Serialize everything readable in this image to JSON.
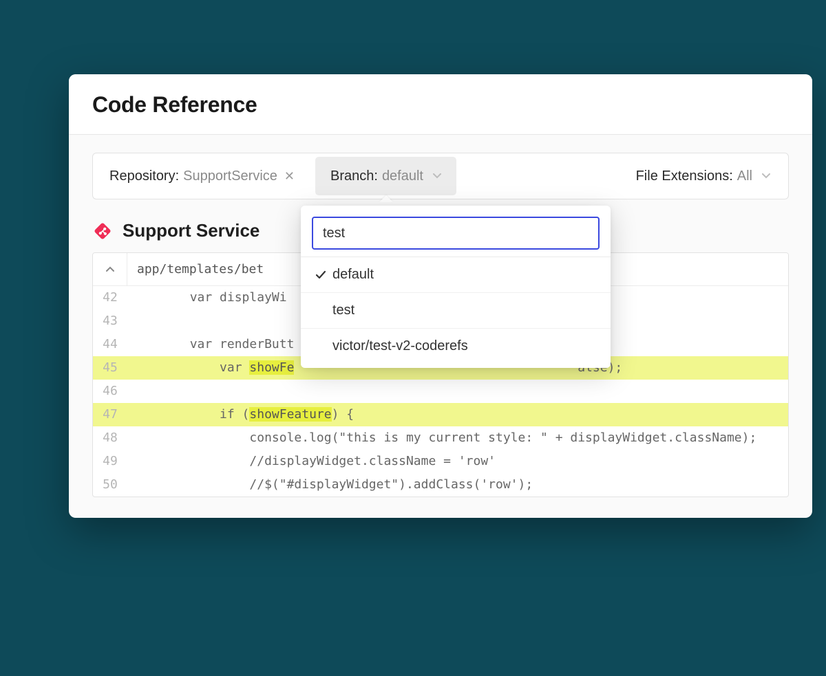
{
  "header": {
    "title": "Code Reference"
  },
  "filters": {
    "repository": {
      "label": "Repository:",
      "value": "SupportService"
    },
    "branch": {
      "label": "Branch:",
      "value": "default"
    },
    "extensions": {
      "label": "File Extensions:",
      "value": "All"
    }
  },
  "branch_dropdown": {
    "search_value": "test",
    "options": [
      {
        "label": "default",
        "selected": true
      },
      {
        "label": "test",
        "selected": false
      },
      {
        "label": "victor/test-v2-coderefs",
        "selected": false
      }
    ]
  },
  "section": {
    "title": "Support Service"
  },
  "file": {
    "path_visible": "app/templates/bet",
    "lines": [
      {
        "num": "42",
        "hl": false,
        "pre": "        var displayWi",
        "tok": "",
        "post": ""
      },
      {
        "num": "43",
        "hl": false,
        "pre": "",
        "tok": "",
        "post": ""
      },
      {
        "num": "44",
        "hl": false,
        "pre": "        var renderButt",
        "tok": "",
        "post": ""
      },
      {
        "num": "45",
        "hl": true,
        "pre": "            var ",
        "tok": "showFe",
        "post": "                                      alse);"
      },
      {
        "num": "46",
        "hl": false,
        "pre": "",
        "tok": "",
        "post": ""
      },
      {
        "num": "47",
        "hl": true,
        "pre": "            if (",
        "tok": "showFeature",
        "post": ") {"
      },
      {
        "num": "48",
        "hl": false,
        "pre": "                console.log(\"this is my current style: \" + displayWidget.className);",
        "tok": "",
        "post": ""
      },
      {
        "num": "49",
        "hl": false,
        "pre": "                //displayWidget.className = 'row'",
        "tok": "",
        "post": ""
      },
      {
        "num": "50",
        "hl": false,
        "pre": "                //$(\"#displayWidget\").addClass('row');",
        "tok": "",
        "post": ""
      }
    ]
  },
  "colors": {
    "page_bg": "#0e4a59",
    "accent_blue": "#3b49df",
    "highlight_line": "#f1f78e",
    "highlight_token": "#e7ef3f",
    "repo_icon": "#ef2d56"
  }
}
